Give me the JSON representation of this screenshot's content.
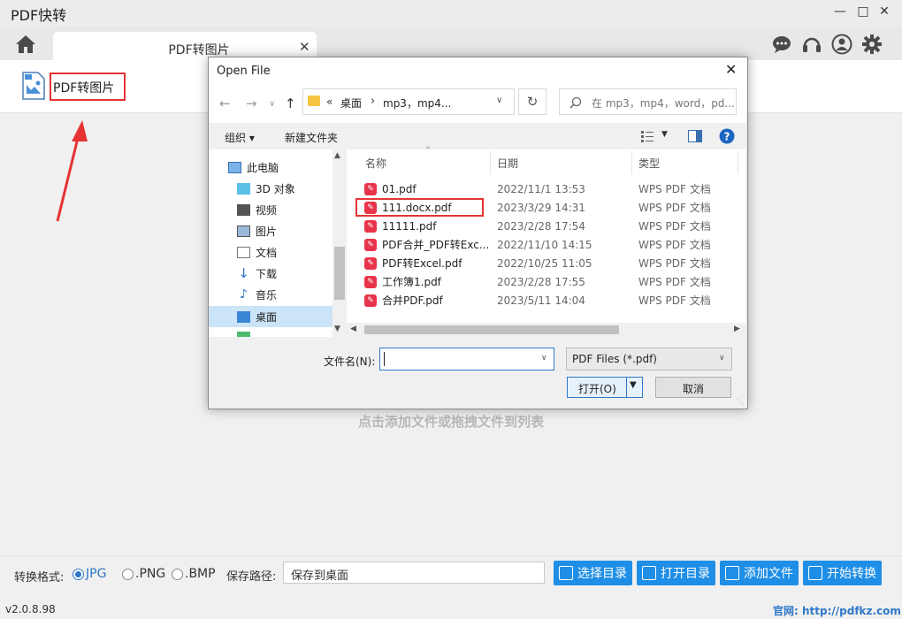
{
  "app": {
    "title": "PDF快转",
    "tab_label": "PDF转图片",
    "tool_label": "PDF转图片",
    "drop_hint": "点击添加文件或拖拽文件到列表",
    "format_label": "转换格式:",
    "formats": [
      "JPG",
      ".PNG",
      ".BMP"
    ],
    "selected_format": "JPG",
    "save_path_label": "保存路径:",
    "save_path_value": "保存到桌面",
    "buttons": {
      "select_dir": "选择目录",
      "open_dir": "打开目录",
      "add_file": "添加文件",
      "start": "开始转换"
    },
    "version": "v2.0.8.98",
    "website": "官网:   http://pdfkz.com"
  },
  "dialog": {
    "title": "Open File",
    "breadcrumb": [
      "«",
      "桌面",
      "›",
      "mp3，mp4..."
    ],
    "search_placeholder": "在 mp3，mp4，word，pd...",
    "organize_label": "组织 ▾",
    "new_folder_label": "新建文件夹",
    "tree": [
      {
        "label": "此电脑",
        "icon": "computer-icon"
      },
      {
        "label": "3D 对象",
        "icon": "cube-icon"
      },
      {
        "label": "视频",
        "icon": "video-icon"
      },
      {
        "label": "图片",
        "icon": "picture-icon"
      },
      {
        "label": "文档",
        "icon": "document-icon"
      },
      {
        "label": "下载",
        "icon": "download-icon"
      },
      {
        "label": "音乐",
        "icon": "music-icon"
      },
      {
        "label": "桌面",
        "icon": "desktop-icon",
        "selected": true
      }
    ],
    "columns": [
      "名称",
      "日期",
      "类型"
    ],
    "files": [
      {
        "name": "01.pdf",
        "date": "2022/11/1 13:53",
        "type": "WPS PDF 文档"
      },
      {
        "name": "111.docx.pdf",
        "date": "2023/3/29 14:31",
        "type": "WPS PDF 文档",
        "highlighted": true
      },
      {
        "name": "11111.pdf",
        "date": "2023/2/28 17:54",
        "type": "WPS PDF 文档"
      },
      {
        "name": "PDF合并_PDF转Exc...",
        "date": "2022/11/10 14:15",
        "type": "WPS PDF 文档"
      },
      {
        "name": "PDF转Excel.pdf",
        "date": "2022/10/25 11:05",
        "type": "WPS PDF 文档"
      },
      {
        "name": "工作簿1.pdf",
        "date": "2023/2/28 17:55",
        "type": "WPS PDF 文档"
      },
      {
        "name": "合并PDF.pdf",
        "date": "2023/5/11 14:04",
        "type": "WPS PDF 文档"
      }
    ],
    "filename_label": "文件名(N):",
    "filename_value": "",
    "filter_value": "PDF Files (*.pdf)",
    "open_label": "打开(O)",
    "cancel_label": "取消"
  },
  "colors": {
    "accent": "#1e8ee6",
    "highlight_red": "#e53333",
    "pdf_red": "#e8344a"
  }
}
